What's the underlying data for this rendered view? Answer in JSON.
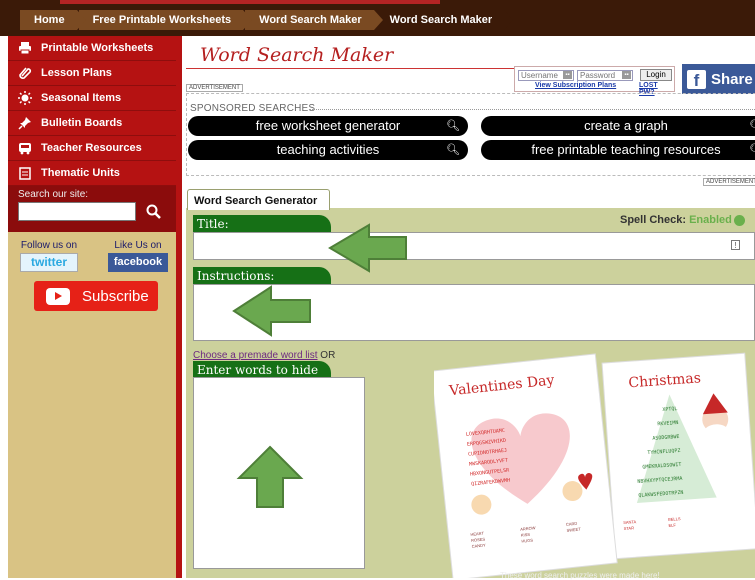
{
  "breadcrumbs": [
    "Home",
    "Free Printable Worksheets",
    "Word Search Maker",
    "Word Search Maker"
  ],
  "sidebar": {
    "items": [
      {
        "label": "Printable Worksheets",
        "icon": "printer-icon"
      },
      {
        "label": "Lesson Plans",
        "icon": "paperclip-icon"
      },
      {
        "label": "Seasonal Items",
        "icon": "sun-icon"
      },
      {
        "label": "Bulletin Boards",
        "icon": "pushpin-icon"
      },
      {
        "label": "Teacher Resources",
        "icon": "bus-icon"
      },
      {
        "label": "Thematic Units",
        "icon": "calendar-icon"
      }
    ],
    "search_label": "Search our site:",
    "follow_label": "Follow us on",
    "like_label": "Like Us on",
    "twitter_label": "twitter",
    "facebook_label": "facebook",
    "subscribe_label": "Subscribe"
  },
  "page_title": "Word Search Maker",
  "ad_label": "ADVERTISEMENT",
  "login": {
    "username_placeholder": "Username",
    "password_placeholder": "Password",
    "login_label": "Login",
    "plans_link": "View Subscription Plans",
    "lost_link": "LOST PW?"
  },
  "share_label": "Share",
  "sponsored": {
    "header": "SPONSORED SEARCHES",
    "corner_link": "D",
    "links": [
      "free worksheet generator",
      "create a graph",
      "teaching activities",
      "free printable teaching resources"
    ]
  },
  "ad_label2": "ADVERTISEMENT",
  "generator": {
    "tab_label": "Word Search Generator",
    "title_header": "Title:",
    "spell_check_label": "Spell Check:",
    "spell_check_value": "Enabled",
    "instructions_header": "Instructions:",
    "premade_link": "Choose a premade word list",
    "or_text": "OR",
    "words_header": "Enter words to hide",
    "puzzle1_title": "Valentines Day",
    "puzzle2_title": "Christmas",
    "caption": "These word search puzzles were made here!"
  },
  "colors": {
    "nav_red": "#b51212",
    "sidebar_tan": "#d9c384",
    "header_green": "#167016",
    "arrow_green": "#6aa84f",
    "panel_olive": "#ccd19c"
  }
}
